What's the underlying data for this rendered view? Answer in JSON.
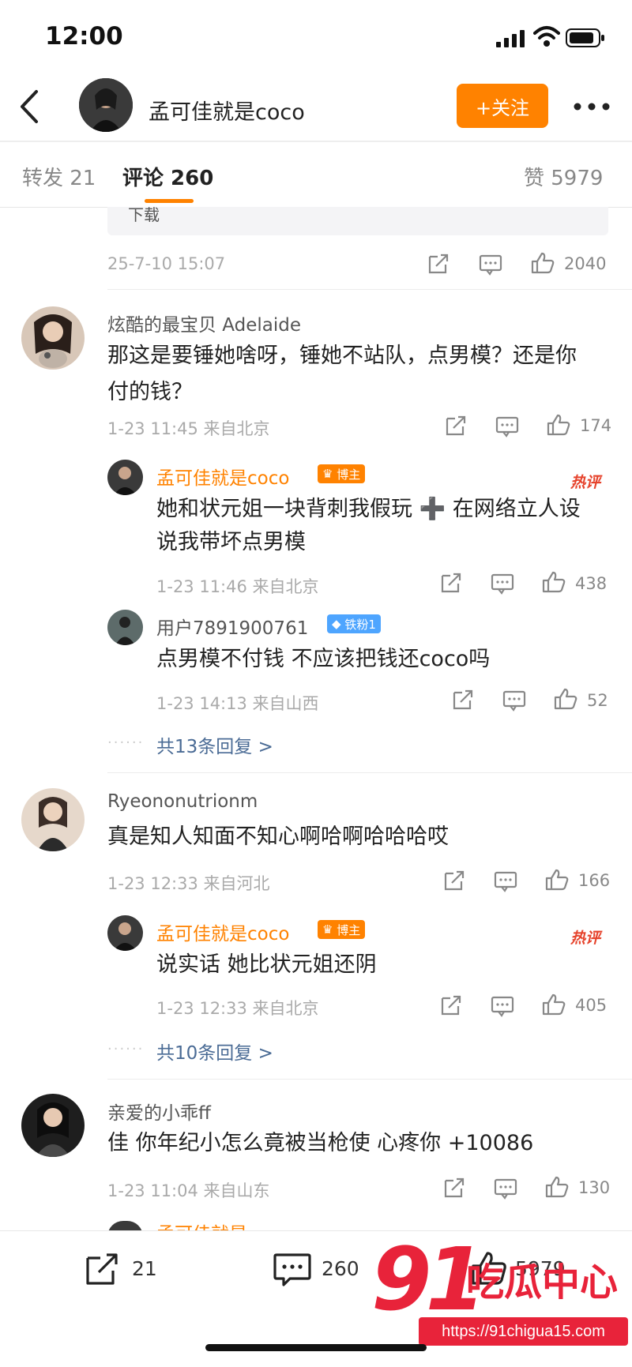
{
  "status": {
    "time": "12:00"
  },
  "header": {
    "username": "孟可佳就是coco",
    "follow_label": "+关注"
  },
  "tabs": {
    "repost": "转发 21",
    "comment": "评论 260",
    "like": "赞 5979"
  },
  "post": {
    "card_fragment": "下载",
    "timestamp": "25-7-10 15:07",
    "like_count": "2040"
  },
  "comments": [
    {
      "user": "炫酷的最宝贝 Adelaide",
      "text_line1": "那这是要锤她啥呀，锤她不站队，点男模？还是你",
      "text_line2": "付的钱？",
      "meta": "1-23 11:45 来自北京",
      "likes": "174",
      "replies": [
        {
          "user": "孟可佳就是coco",
          "badge": "博主",
          "hot": "热评",
          "text_line1": "她和状元姐一块背刺我假玩 ➕ 在网络立人设",
          "text_line2": "说我带坏点男模",
          "meta": "1-23 11:46 来自北京",
          "likes": "438"
        },
        {
          "user": "用户7891900761",
          "badge": "铁粉1",
          "text_line1": "点男模不付钱 不应该把钱还coco吗",
          "meta": "1-23 14:13 来自山西",
          "likes": "52"
        }
      ],
      "more_replies": "共13条回复 >"
    },
    {
      "user": "Ryeononutrionm",
      "text_line1": "真是知人知面不知心啊哈啊哈哈哈哎",
      "meta": "1-23 12:33 来自河北",
      "likes": "166",
      "replies": [
        {
          "user": "孟可佳就是coco",
          "badge": "博主",
          "hot": "热评",
          "text_line1": "说实话 她比状元姐还阴",
          "meta": "1-23 12:33 来自北京",
          "likes": "405"
        }
      ],
      "more_replies": "共10条回复 >"
    },
    {
      "user": "亲爱的小乖ff",
      "text_line1": "佳 你年纪小怎么竟被当枪使 心疼你 +10086",
      "meta": "1-23 11:04 来自山东",
      "likes": "130",
      "partial_reply_user": "孟可佳就是"
    }
  ],
  "bottom": {
    "repost": "21",
    "comment": "260",
    "like": "5979"
  },
  "watermark": {
    "number": "91",
    "text": "吃瓜中心",
    "url": "https://91chigua15.com"
  },
  "colors": {
    "accent": "#ff8200",
    "link": "#4a6b95",
    "hot": "#e6432c",
    "watermark": "#e8233a"
  }
}
